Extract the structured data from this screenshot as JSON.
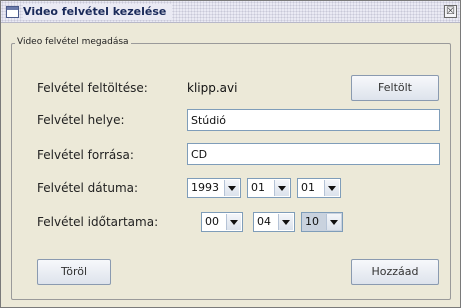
{
  "window": {
    "title": "Video felvétel kezelése",
    "close_glyph": "☒"
  },
  "group": {
    "legend": "Video felvétel megadása"
  },
  "form": {
    "upload_label": "Felvétel feltöltése:",
    "file_name": "klipp.avi",
    "upload_button": "Feltölt",
    "location_label": "Felvétel helye:",
    "location_value": "Stúdió",
    "source_label": "Felvétel forrása:",
    "source_value": "CD",
    "date_label": "Felvétel dátuma:",
    "date_year": "1993",
    "date_month": "01",
    "date_day": "01",
    "duration_label": "Felvétel időtartama:",
    "duration_hours": "00",
    "duration_minutes": "04",
    "duration_seconds": "10"
  },
  "actions": {
    "delete_button": "Töröl",
    "add_button": "Hozzáad"
  },
  "icons": {
    "window_icon": "window-icon",
    "close_icon": "close-icon",
    "dropdown_icon": "chevron-down-icon"
  }
}
